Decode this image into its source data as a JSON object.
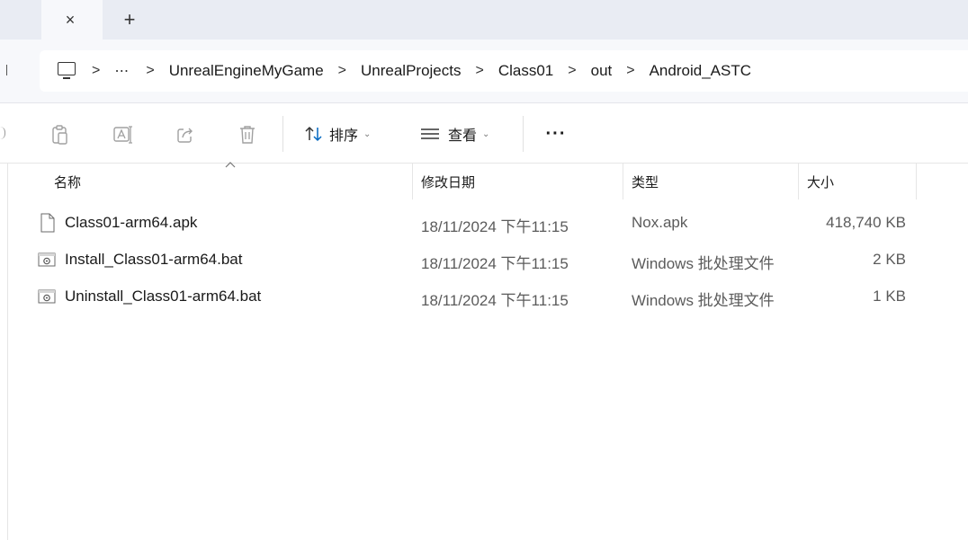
{
  "tabs": {
    "close_glyph": "×",
    "new_glyph": "+"
  },
  "address": {
    "ellipsis": "⋯",
    "separator": ">",
    "crumbs": [
      "UnrealEngineMyGame",
      "UnrealProjects",
      "Class01",
      "out",
      "Android_ASTC"
    ]
  },
  "toolbar": {
    "sort_label": "排序",
    "view_label": "查看",
    "chevron": "⌄",
    "more_label": "···",
    "icons": [
      "paste-icon",
      "rename-icon",
      "share-icon",
      "delete-icon",
      "sort-icon",
      "view-icon"
    ]
  },
  "columns": {
    "name": "名称",
    "modified": "修改日期",
    "type": "类型",
    "size": "大小"
  },
  "files": [
    {
      "name": "Class01-arm64.apk",
      "modified": "18/11/2024 下午11:15",
      "type": "Nox.apk",
      "size": "418,740 KB",
      "icon": "generic-file-icon"
    },
    {
      "name": "Install_Class01-arm64.bat",
      "modified": "18/11/2024 下午11:15",
      "type": "Windows 批处理文件",
      "size": "2 KB",
      "icon": "batch-file-icon"
    },
    {
      "name": "Uninstall_Class01-arm64.bat",
      "modified": "18/11/2024 下午11:15",
      "type": "Windows 批处理文件",
      "size": "1 KB",
      "icon": "batch-file-icon"
    }
  ],
  "colors": {
    "tabstrip_bg": "#e9ecf3",
    "addr_row_bg": "#f7f8fb",
    "muted_text": "#5b5b5b",
    "disabled_icon": "#a0a0a0"
  }
}
